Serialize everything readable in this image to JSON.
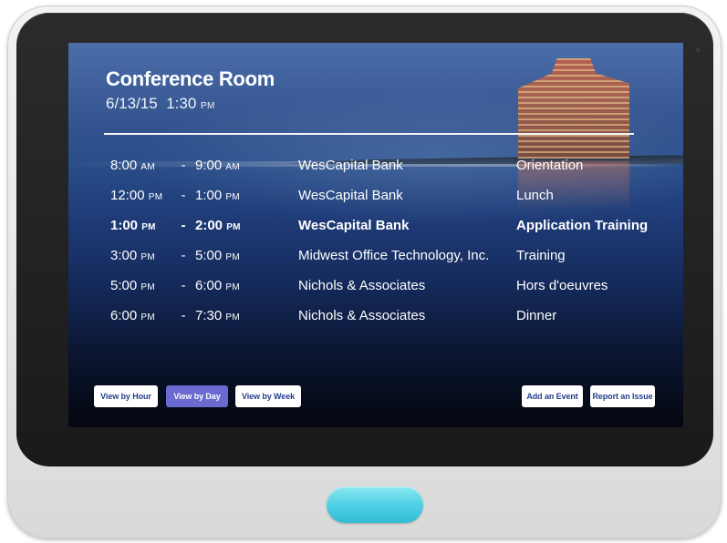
{
  "header": {
    "room_name": "Conference Room",
    "date": "6/13/15",
    "time": "1:30",
    "time_ampm": "PM"
  },
  "schedule": [
    {
      "start": "8:00",
      "start_ampm": "AM",
      "end": "9:00",
      "end_ampm": "AM",
      "organization": "WesCapital Bank",
      "event": "Orientation",
      "current": false
    },
    {
      "start": "12:00",
      "start_ampm": "PM",
      "end": "1:00",
      "end_ampm": "PM",
      "organization": "WesCapital Bank",
      "event": "Lunch",
      "current": false
    },
    {
      "start": "1:00",
      "start_ampm": "PM",
      "end": "2:00",
      "end_ampm": "PM",
      "organization": "WesCapital Bank",
      "event": "Application Training",
      "current": true
    },
    {
      "start": "3:00",
      "start_ampm": "PM",
      "end": "5:00",
      "end_ampm": "PM",
      "organization": "Midwest Office Technology, Inc.",
      "event": "Training",
      "current": false
    },
    {
      "start": "5:00",
      "start_ampm": "PM",
      "end": "6:00",
      "end_ampm": "PM",
      "organization": "Nichols & Associates",
      "event": "Hors d'oeuvres",
      "current": false
    },
    {
      "start": "6:00",
      "start_ampm": "PM",
      "end": "7:30",
      "end_ampm": "PM",
      "organization": "Nichols & Associates",
      "event": "Dinner",
      "current": false
    }
  ],
  "separator": "-",
  "view_buttons": [
    {
      "label": "View by Hour",
      "active": false
    },
    {
      "label": "View by Day",
      "active": true
    },
    {
      "label": "View by Week",
      "active": false
    }
  ],
  "action_buttons": {
    "add_event": "Add an Event",
    "report_issue": "Report an Issue"
  },
  "colors": {
    "active_button": "#6a6ad0",
    "button_text": "#233e8e",
    "home_button": "#4fd0e4"
  }
}
